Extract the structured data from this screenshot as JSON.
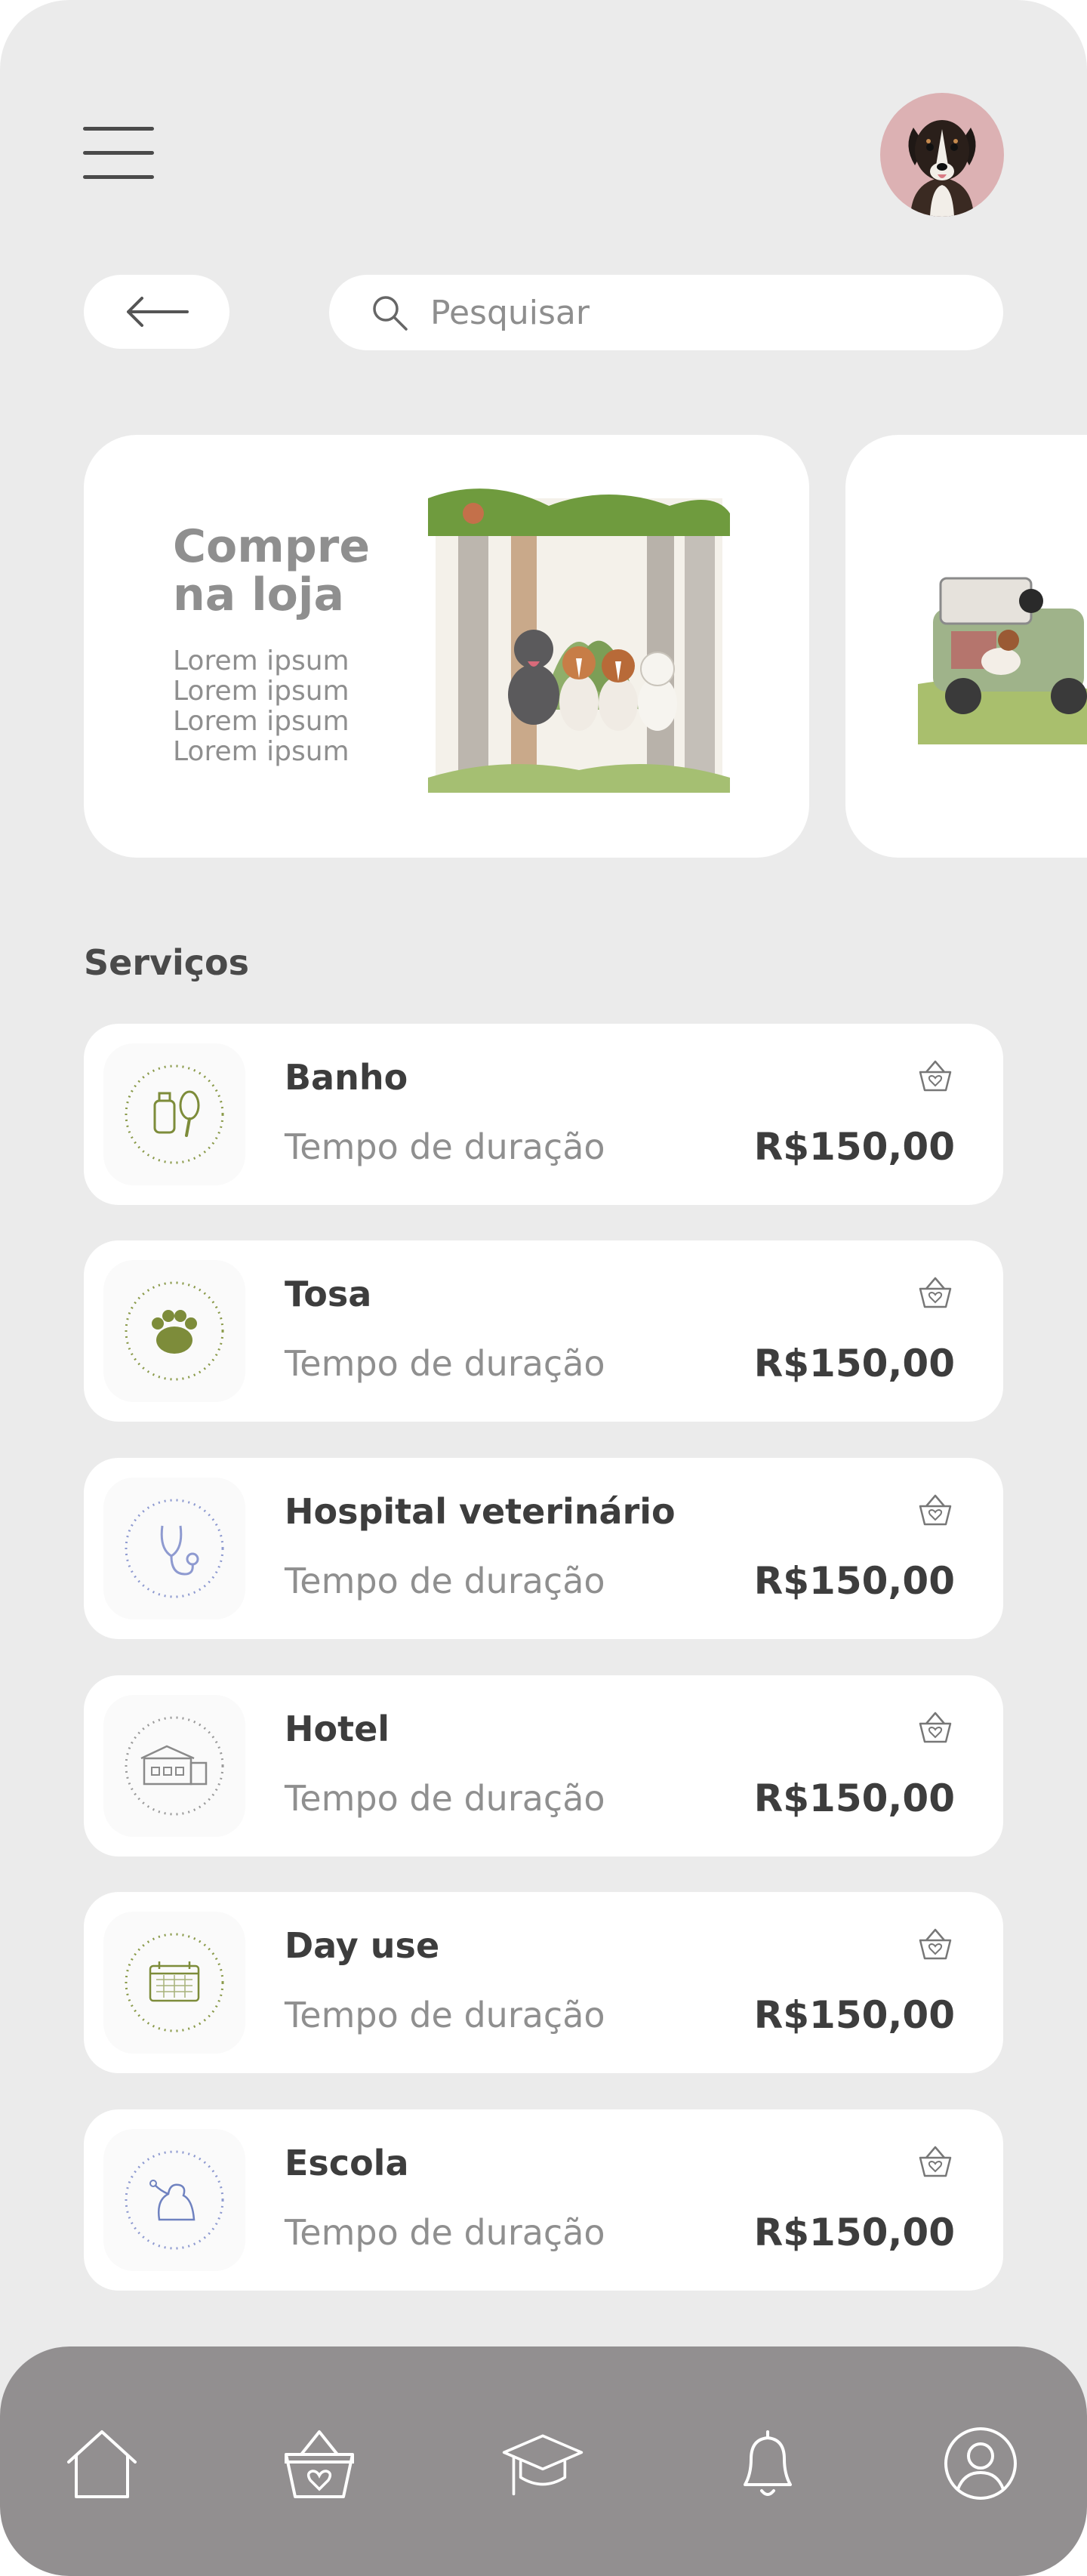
{
  "header": {
    "menu_icon": "hamburger-menu-icon",
    "avatar_icon": "dog-avatar"
  },
  "search": {
    "back_icon": "arrow-left-icon",
    "icon": "search-icon",
    "placeholder": "Pesquisar"
  },
  "promos": [
    {
      "title": "Compre na loja",
      "lines": [
        "Lorem ipsum",
        "Lorem ipsum",
        "Lorem ipsum",
        "Lorem ipsum"
      ]
    }
  ],
  "services_title": "Serviços",
  "services": [
    {
      "name": "Banho",
      "duration": "Tempo de duração",
      "price": "R$150,00",
      "icon": "bath-icon"
    },
    {
      "name": "Tosa",
      "duration": "Tempo de duração",
      "price": "R$150,00",
      "icon": "paw-icon"
    },
    {
      "name": "Hospital veterinário",
      "duration": "Tempo de duração",
      "price": "R$150,00",
      "icon": "stethoscope-icon"
    },
    {
      "name": "Hotel",
      "duration": "Tempo de duração",
      "price": "R$150,00",
      "icon": "hotel-icon"
    },
    {
      "name": "Day use",
      "duration": "Tempo de duração",
      "price": "R$150,00",
      "icon": "calendar-icon"
    },
    {
      "name": "Escola",
      "duration": "Tempo de duração",
      "price": "R$150,00",
      "icon": "dog-school-icon"
    }
  ],
  "bottom_nav": [
    "home-icon",
    "basket-heart-icon",
    "graduation-cap-icon",
    "bell-icon",
    "user-profile-icon"
  ],
  "colors": {
    "background": "#ebebeb",
    "card": "#ffffff",
    "nav": "#928f90",
    "avatar_bg": "#dcb1b3",
    "accent_green": "#7d8c3a"
  }
}
